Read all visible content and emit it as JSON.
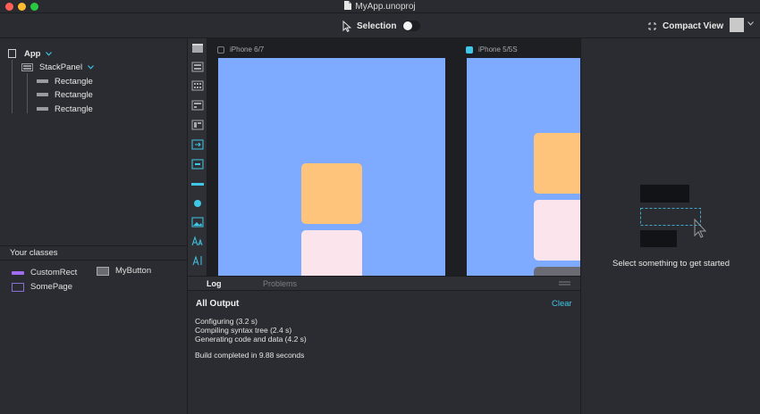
{
  "window": {
    "title": "MyApp.unoproj"
  },
  "toolbar": {
    "selection_label": "Selection",
    "selection_enabled": true,
    "compact_view_label": "Compact View",
    "color_swatch": "#c9c9c9"
  },
  "tree": {
    "root": "App",
    "stackpanel": "StackPanel",
    "children": [
      "Rectangle",
      "Rectangle",
      "Rectangle"
    ]
  },
  "classes": {
    "title": "Your classes",
    "items": [
      {
        "label": "CustomRect",
        "color": "#a06cf2"
      },
      {
        "label": "MyButton",
        "color": "#8f9097"
      },
      {
        "label": "SomePage",
        "color": "#8a6fd8"
      }
    ]
  },
  "palette": {
    "icons": [
      "page-icon",
      "panel-icon",
      "grid-icon",
      "dockpanel-icon",
      "columns-icon",
      "scrollview-icon",
      "pageview-icon",
      "line-icon",
      "circle-icon",
      "image-icon",
      "text-icon",
      "textinput-icon"
    ],
    "accent": "#3fc7e8"
  },
  "canvas": {
    "devices": [
      {
        "label": "iPhone 6/7",
        "active": false
      },
      {
        "label": "iPhone 5/5S",
        "active": true
      }
    ],
    "screen_color": "#7eaaff",
    "block_colors": {
      "orange": "#fec47c",
      "pink": "#fce4ec",
      "grey": "#6b6c73"
    }
  },
  "log": {
    "tabs": [
      "Log",
      "Problems"
    ],
    "active_tab": "Log",
    "title": "All Output",
    "clear_label": "Clear",
    "lines": [
      "Configuring (3.2 s)",
      "Compiling syntax tree (2.4 s)",
      "Generating code and data (4.2 s)",
      "Build completed in 9.88 seconds"
    ]
  },
  "inspector": {
    "hint": "Select something to get started"
  }
}
